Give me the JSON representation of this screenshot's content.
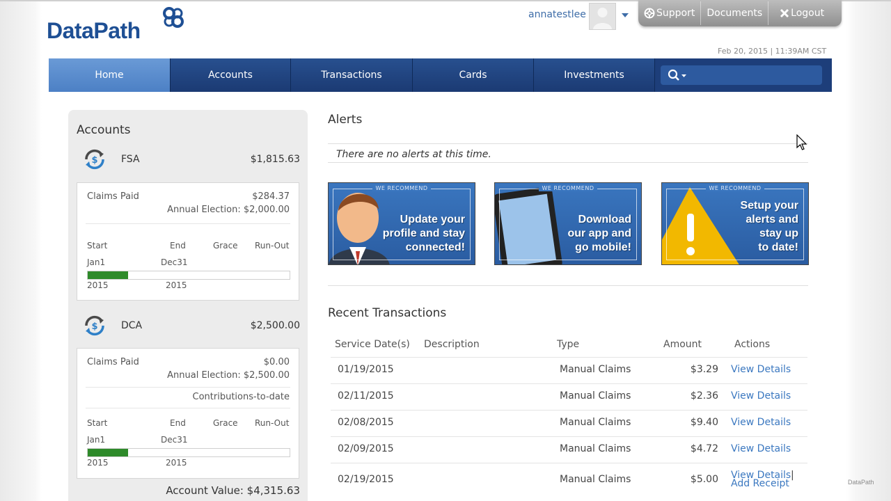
{
  "header": {
    "logo_text": "DataPath",
    "username": "annatestlee",
    "datetime": "Feb 20, 2015 | 11:39AM CST"
  },
  "utility": {
    "support": "Support",
    "documents": "Documents",
    "logout": "Logout"
  },
  "nav": {
    "items": [
      "Home",
      "Accounts",
      "Transactions",
      "Cards",
      "Investments"
    ],
    "active": "Home",
    "search_placeholder": ""
  },
  "accounts": {
    "title": "Accounts",
    "fsa": {
      "name": "FSA",
      "balance": "$1,815.63",
      "claims_label": "Claims Paid",
      "claims_value": "$284.37",
      "annual_election": "Annual Election: $2,000.00",
      "start_label": "Start",
      "end_label": "End",
      "grace_label": "Grace",
      "runout_label": "Run-Out",
      "start_date": "Jan1",
      "end_date": "Dec31",
      "start_year": "2015",
      "end_year": "2015",
      "progress": 0.2
    },
    "dca": {
      "name": "DCA",
      "balance": "$2,500.00",
      "claims_label": "Claims Paid",
      "claims_value": "$0.00",
      "annual_election": "Annual Election: $2,500.00",
      "contributions_label": "Contributions-to-date",
      "start_label": "Start",
      "end_label": "End",
      "grace_label": "Grace",
      "runout_label": "Run-Out",
      "start_date": "Jan1",
      "end_date": "Dec31",
      "start_year": "2015",
      "end_year": "2015",
      "progress": 0.2
    },
    "account_value": "Account Value: $4,315.63"
  },
  "alerts": {
    "title": "Alerts",
    "message": "There are no alerts at this time."
  },
  "promos": [
    {
      "badge": "WE RECOMMEND",
      "line1": "Update your",
      "line2": "profile and stay",
      "line3": "connected!"
    },
    {
      "badge": "WE RECOMMEND",
      "line1": "Download",
      "line2": "our app and",
      "line3": "go mobile!"
    },
    {
      "badge": "WE RECOMMEND",
      "line1": "Setup your",
      "line2": "alerts and",
      "line3": "stay up",
      "line4": "to date!"
    }
  ],
  "transactions": {
    "title": "Recent Transactions",
    "headers": {
      "date": "Service Date(s)",
      "description": "Description",
      "type": "Type",
      "amount": "Amount",
      "actions": "Actions"
    },
    "rows": [
      {
        "date": "01/19/2015",
        "description": "",
        "type": "Manual Claims",
        "amount": "$3.29",
        "action": "View Details"
      },
      {
        "date": "02/11/2015",
        "description": "",
        "type": "Manual Claims",
        "amount": "$2.36",
        "action": "View Details"
      },
      {
        "date": "02/08/2015",
        "description": "",
        "type": "Manual Claims",
        "amount": "$9.40",
        "action": "View Details"
      },
      {
        "date": "02/09/2015",
        "description": "",
        "type": "Manual Claims",
        "amount": "$4.72",
        "action": "View Details"
      },
      {
        "date": "02/19/2015",
        "description": "",
        "type": "Manual Claims",
        "amount": "$5.00",
        "action": "View Details",
        "action2": "Add Receipt"
      }
    ]
  },
  "watermark": "DataPath",
  "colors": {
    "brand": "#1e4f94",
    "nav": "#1d3e7a",
    "nav_active": "#5a8dcf",
    "progress": "#2e8a2a",
    "link": "#3b78c0"
  }
}
